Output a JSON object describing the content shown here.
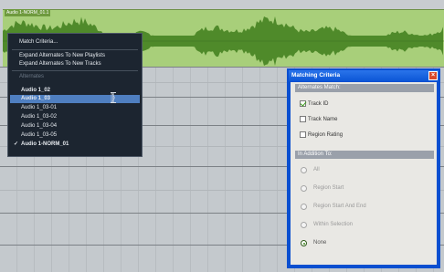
{
  "clip": {
    "label": "Audio 1-NORM_01.1"
  },
  "menu": {
    "match_criteria": "Match Criteria...",
    "expand_playlists": "Expand Alternates To New Playlists",
    "expand_tracks": "Expand Alternates To New Tracks",
    "alternates_header": "Alternates",
    "items": [
      "Audio 1_02",
      "Audio 1_03",
      "Audio 1_03-01",
      "Audio 1_03-02",
      "Audio 1_03-04",
      "Audio 1_03-05",
      "Audio 1-NORM_01"
    ],
    "selected_index": 1,
    "checked_index": 6,
    "checkmark": "✓"
  },
  "dialog": {
    "title": "Matching Criteria",
    "close_glyph": "×",
    "alternates_match": "Alternates Match:",
    "checks": [
      {
        "label": "Track ID",
        "checked": true
      },
      {
        "label": "Track Name",
        "checked": false
      },
      {
        "label": "Region Rating",
        "checked": false
      }
    ],
    "in_addition": "In Addition To:",
    "radios": [
      {
        "label": "All",
        "selected": false
      },
      {
        "label": "Region Start",
        "selected": false
      },
      {
        "label": "Region Start And End",
        "selected": false
      },
      {
        "label": "Within Selection",
        "selected": false
      },
      {
        "label": "None",
        "selected": true
      }
    ]
  },
  "colors": {
    "clip": "#a8cf7a",
    "menu_bg": "#1c2530",
    "selection": "#4f7fc0",
    "dialog_frame": "#0a4fd0"
  }
}
